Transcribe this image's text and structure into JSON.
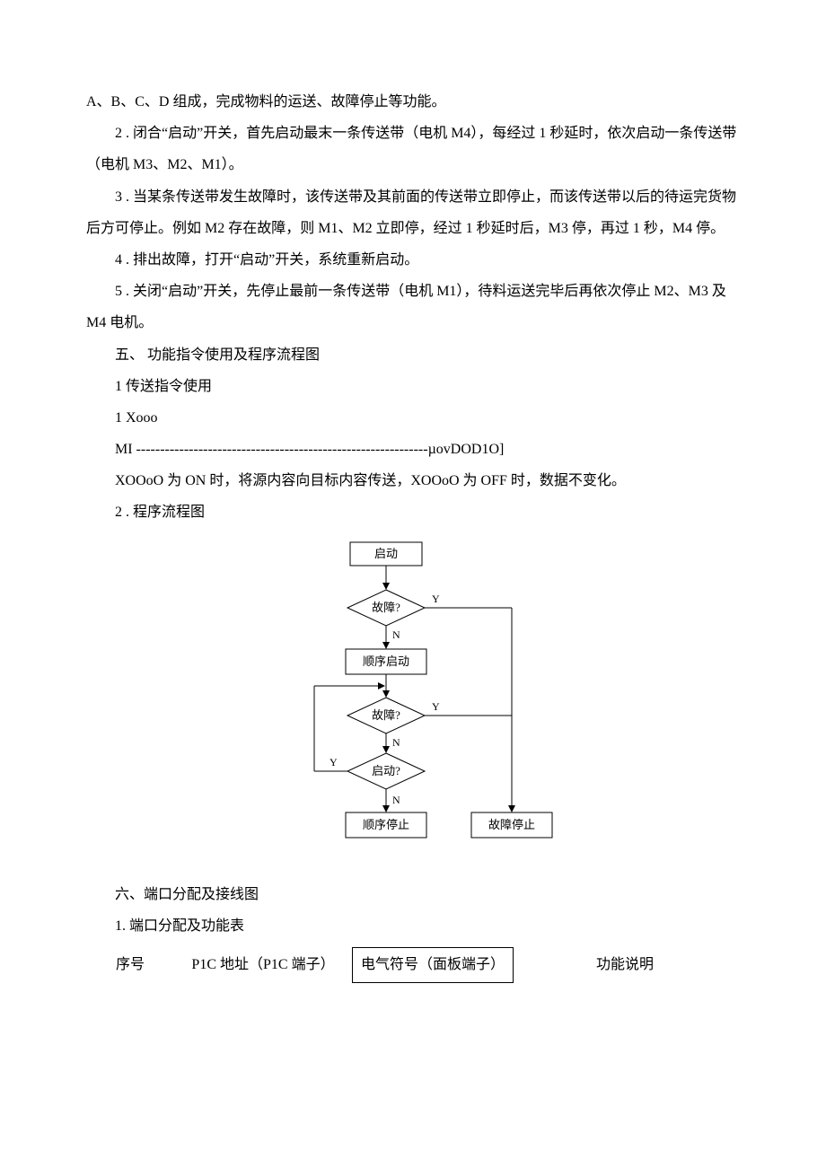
{
  "p1": "A、B、C、D 组成，完成物料的运送、故障停止等功能。",
  "p2": "2 . 闭合“启动”开关，首先启动最末一条传送带（电机 M4），每经过 1 秒延时，依次启动一条传送带（电机 M3、M2、M1）。",
  "p3": "3 . 当某条传送带发生故障时，该传送带及其前面的传送带立即停止，而该传送带以后的待运完货物后方可停止。例如 M2 存在故障，则 M1、M2 立即停，经过 1 秒延时后，M3 停，再过 1 秒，M4 停。",
  "p4": "4 . 排出故障，打开“启动”开关，系统重新启动。",
  "p5": "5 . 关闭“启动”开关，先停止最前一条传送带（电机 M1），待料运送完毕后再依次停止 M2、M3 及 M4 电机。",
  "h5": "五、  功能指令使用及程序流程图",
  "s1": "1 传送指令使用",
  "xooo": "1 Xooo",
  "mi": "MI -------------------------------------------------------------µovDOD1O]",
  "p6": "XOOoO 为 ON 时，将源内容向目标内容传送，XOOoO 为 OFF 时，数据不变化。",
  "s2": "2 . 程序流程图",
  "flow": {
    "start": "启动",
    "fault": "故障?",
    "seq_start": "顺序启动",
    "start_q": "启动?",
    "seq_stop": "顺序停止",
    "fault_stop": "故障停止",
    "Y": "Y",
    "N": "N"
  },
  "h6": "六、端口分配及接线图",
  "s6_1": "1. 端口分配及功能表",
  "table": {
    "c1": "序号",
    "c2": "P1C 地址（P1C 端子）",
    "c3": "电气符号（面板端子）",
    "c4": "功能说明"
  }
}
